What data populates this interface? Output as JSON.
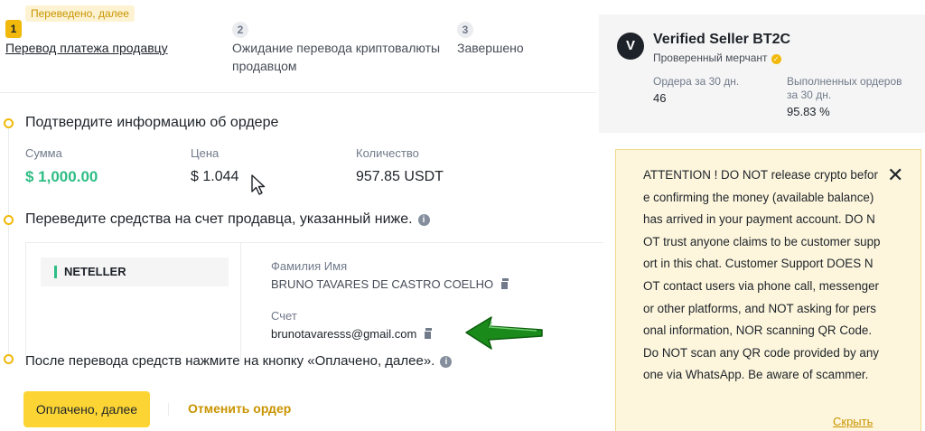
{
  "stepper": {
    "tooltip": "Переведено, далее",
    "steps": [
      {
        "num": "1",
        "label": "Перевод платежа продавцу"
      },
      {
        "num": "2",
        "label": "Ожидание перевода криптовалюты продавцом"
      },
      {
        "num": "3",
        "label": "Завершено"
      }
    ]
  },
  "order": {
    "confirm_title": "Подтвердите информацию об ордере",
    "amount_label": "Сумма",
    "amount_value": "$ 1,000.00",
    "price_label": "Цена",
    "price_value": "$ 1.044",
    "qty_label": "Количество",
    "qty_value": "957.85 USDT",
    "transfer_title": "Переведите средства на счет продавца, указанный ниже.",
    "payment_method": "NETELLER",
    "name_label": "Фамилия Имя",
    "name_value": "BRUNO TAVARES DE CASTRO COELHO",
    "account_label": "Счет",
    "account_value": "brunotavaresss@gmail.com",
    "after_title": "После перевода средств нажмите на кнопку «Оплачено, далее».",
    "paid_button": "Оплачено, далее",
    "cancel_button": "Отменить ордер"
  },
  "seller": {
    "avatar_letter": "V",
    "name": "Verified Seller BT2C",
    "badge": "Проверенный мерчант",
    "orders_label": "Ордера за 30 дн.",
    "orders_value": "46",
    "completed_label_1": "Выполненных ордеров",
    "completed_label_2": "за 30 дн.",
    "completed_value": "95.83 %"
  },
  "warning": {
    "text": "ATTENTION ! DO NOT release crypto before confirming the money (available balance) has arrived in your payment account. DO NOT trust anyone claims to be customer support in this chat. Customer Support DOES NOT contact users via phone call, messenger or other platforms, and NOT asking for personal information, NOR scanning QR Code. Do NOT scan any QR code provided by anyone via WhatsApp. Be aware of scammer.",
    "close": "✕",
    "hide": "Скрыть"
  },
  "colors": {
    "accent": "#f0b90b",
    "button": "#fcd535",
    "green": "#2ebd85",
    "arrow": "#1a8a1a"
  }
}
